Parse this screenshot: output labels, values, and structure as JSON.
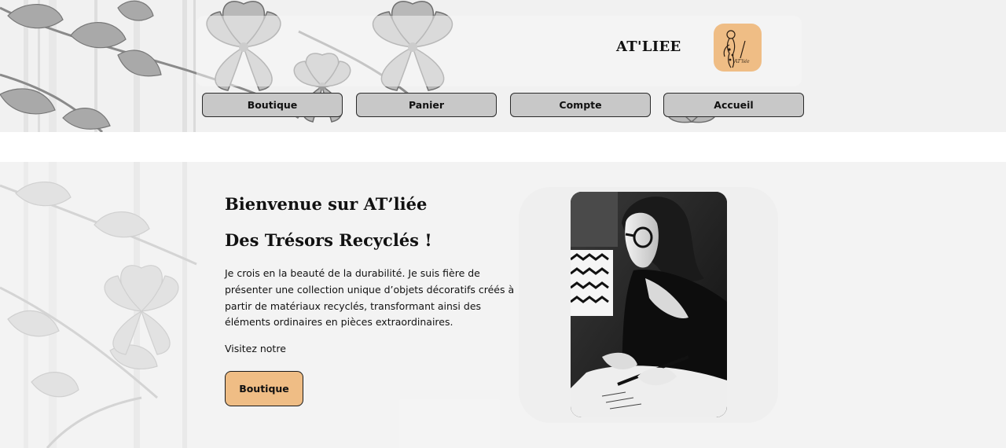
{
  "header": {
    "brand": "AT'LIEE",
    "logo_script": "AT'liée",
    "nav": [
      {
        "label": "Boutique"
      },
      {
        "label": "Panier"
      },
      {
        "label": "Compte"
      },
      {
        "label": "Accueil"
      }
    ]
  },
  "hero": {
    "title": "Bienvenue sur AT’liée",
    "subtitle": "Des Trésors Recyclés !",
    "paragraph": "Je crois en la beauté de la durabilité. Je suis fière de présenter une collection unique d’objets décoratifs créés à partir de matériaux recyclés, transformant ainsi des éléments ordinaires en pièces extraordinaires.",
    "visit_text": "Visitez notre",
    "cta_label": "Boutique"
  },
  "colors": {
    "accent": "#efbd85",
    "nav_button_bg": "#c8c8c8",
    "header_bg": "#f1f1f1",
    "text": "#111111"
  },
  "icons": {
    "logo": "woman-silhouette-logo",
    "decoration": "floral-engraving-pattern",
    "photo": "artisan-drawing-photo"
  }
}
